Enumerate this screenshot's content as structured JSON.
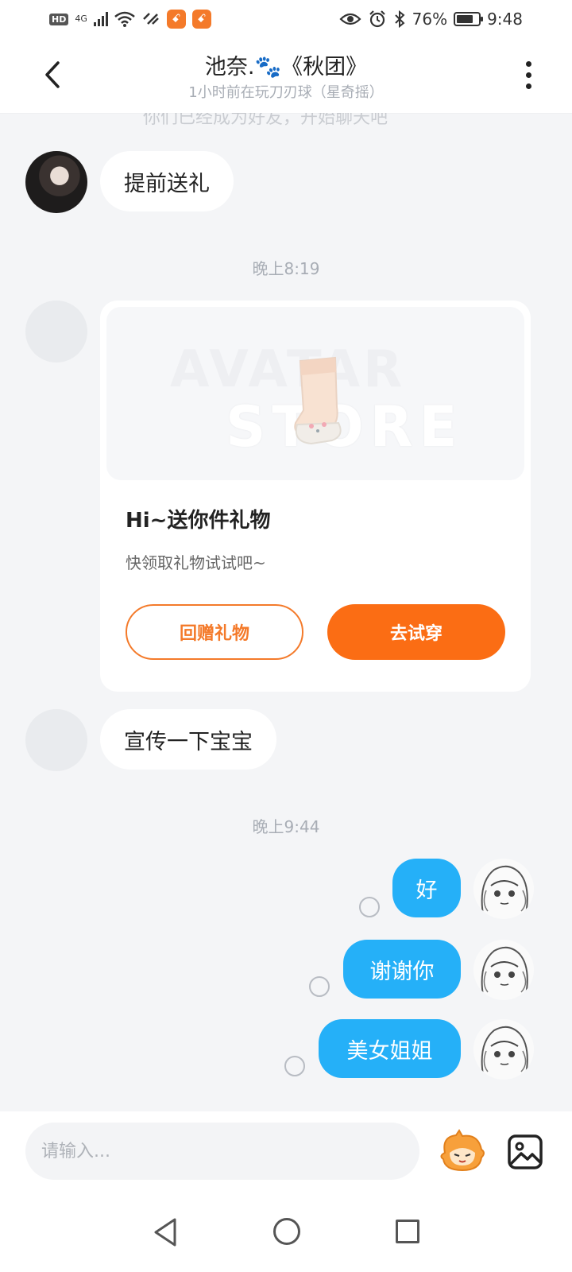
{
  "status_bar": {
    "hd": "HD",
    "network": "4G",
    "battery": "76%",
    "battery_fraction": 0.76,
    "time": "9:48"
  },
  "header": {
    "title_name": "池奈.",
    "title_paw": "🐾",
    "title_group": "《秋团》",
    "subtitle": "1小时前在玩刀刃球（星奇摇）"
  },
  "messages": {
    "partial_text": "你们已经成为好友，开始聊天吧",
    "msg1": "提前送礼",
    "time1": "晚上8:19",
    "gift": {
      "watermark_line1": "AVATAR",
      "watermark_line2": "STORE",
      "title": "Hi~送你件礼物",
      "desc": "快领取礼物试试吧~",
      "return_label": "回赠礼物",
      "try_label": "去试穿"
    },
    "msg2": "宣传一下宝宝",
    "time2": "晚上9:44",
    "out1": "好",
    "out2": "谢谢你",
    "out3": "美女姐姐"
  },
  "input": {
    "placeholder": "请输入..."
  },
  "icons": {
    "back": "chevron-left-icon",
    "more": "more-vertical-icon",
    "sticker": "sticker-mascot-icon",
    "image": "image-icon"
  },
  "colors": {
    "accent_orange": "#fb6d14",
    "bubble_blue": "#25b0f8",
    "background": "#f4f5f7"
  }
}
